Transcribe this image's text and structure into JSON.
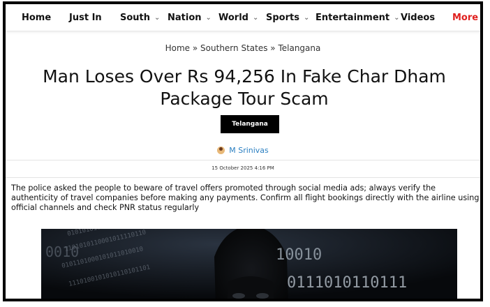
{
  "nav": {
    "items": [
      {
        "label": "Home",
        "has_dropdown": false
      },
      {
        "label": "Just In",
        "has_dropdown": false
      },
      {
        "label": "South",
        "has_dropdown": true
      },
      {
        "label": "Nation",
        "has_dropdown": true
      },
      {
        "label": "World",
        "has_dropdown": true
      },
      {
        "label": "Sports",
        "has_dropdown": true
      },
      {
        "label": "Entertainment",
        "has_dropdown": true
      },
      {
        "label": "Videos",
        "has_dropdown": false
      }
    ],
    "more_label": "More",
    "more_color": "#e0201f"
  },
  "breadcrumb": {
    "home": "Home",
    "sep1": " » ",
    "section": "Southern States",
    "sep2": " » ",
    "current": "Telangana"
  },
  "article": {
    "headline": "Man Loses Over Rs 94,256 In Fake Char Dham Package Tour Scam",
    "category": "Telangana",
    "author": "M Srinivas",
    "date": "15 October 2025 4:16 PM",
    "summary": "The police asked the people to beware of travel offers promoted through social media ads; always verify the authenticity of travel companies before making any payments. Confirm all flight bookings directly with the airline using official channels and check PNR status regularly"
  },
  "hero": {
    "binary_lines": [
      "0101010100101011001001",
      "1101010110001011110110",
      "0101101000101011010010",
      "1110100101010110101101"
    ],
    "overlay_left": "0010",
    "overlay_right_1": "10010",
    "overlay_right_2": "0111010110111"
  }
}
